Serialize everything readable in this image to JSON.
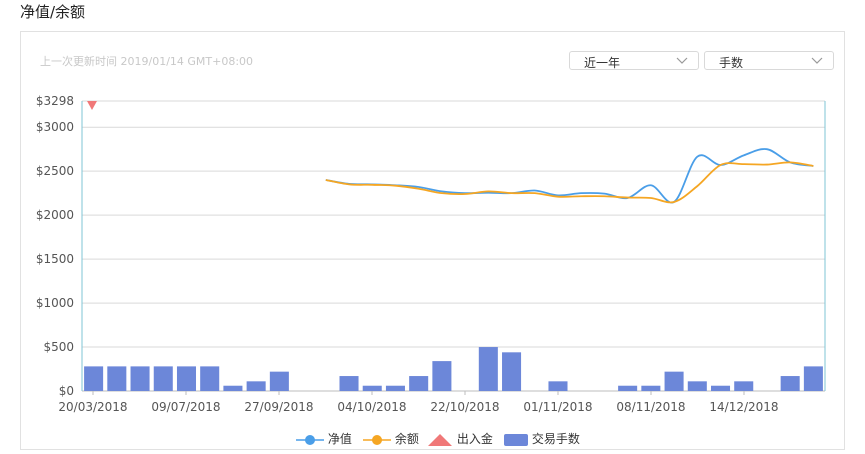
{
  "page_title": "净值/余额",
  "last_updated": "上一次更新时间 2019/01/14 GMT+08:00",
  "controls": {
    "range_select": "近一年",
    "metric_select": "手数"
  },
  "colors": {
    "net_value": "#4a9ee8",
    "balance": "#f5a623",
    "deposit_withdraw": "#f07878",
    "trades": "#6c87d9",
    "grid": "#d9d9d9",
    "axis": "#7fc4d6"
  },
  "chart_data": {
    "type": "line",
    "x_ticks": [
      "20/03/2018",
      "09/07/2018",
      "27/09/2018",
      "04/10/2018",
      "22/10/2018",
      "01/11/2018",
      "08/11/2018",
      "14/12/2018"
    ],
    "y_ticks": [
      "$0",
      "$500",
      "$1000",
      "$1500",
      "$2000",
      "$2500",
      "$3000",
      "$3298"
    ],
    "ylim": [
      0,
      3298
    ],
    "grid": true,
    "legend_position": "bottom",
    "deposit_marker": {
      "name": "出入金",
      "index": 0
    },
    "bars": {
      "name": "交易手数",
      "values": [
        280,
        280,
        280,
        280,
        280,
        280,
        60,
        110,
        220,
        0,
        0,
        170,
        60,
        60,
        170,
        340,
        0,
        500,
        440,
        0,
        110,
        0,
        0,
        60,
        60,
        220,
        110,
        60,
        110,
        0,
        170,
        280
      ]
    },
    "series": [
      {
        "name": "净值",
        "values": [
          null,
          null,
          null,
          null,
          null,
          null,
          null,
          null,
          null,
          null,
          2400,
          2355,
          2350,
          2340,
          2320,
          2270,
          2250,
          2255,
          2250,
          2280,
          2225,
          2250,
          2245,
          2195,
          2340,
          2150,
          2665,
          2570,
          2680,
          2750,
          2600,
          2560
        ]
      },
      {
        "name": "余额",
        "values": [
          null,
          null,
          null,
          null,
          null,
          null,
          null,
          null,
          null,
          null,
          2400,
          2350,
          2345,
          2335,
          2300,
          2250,
          2240,
          2270,
          2250,
          2250,
          2210,
          2215,
          2215,
          2200,
          2195,
          2150,
          2330,
          2570,
          2580,
          2575,
          2600,
          2560
        ]
      }
    ]
  }
}
